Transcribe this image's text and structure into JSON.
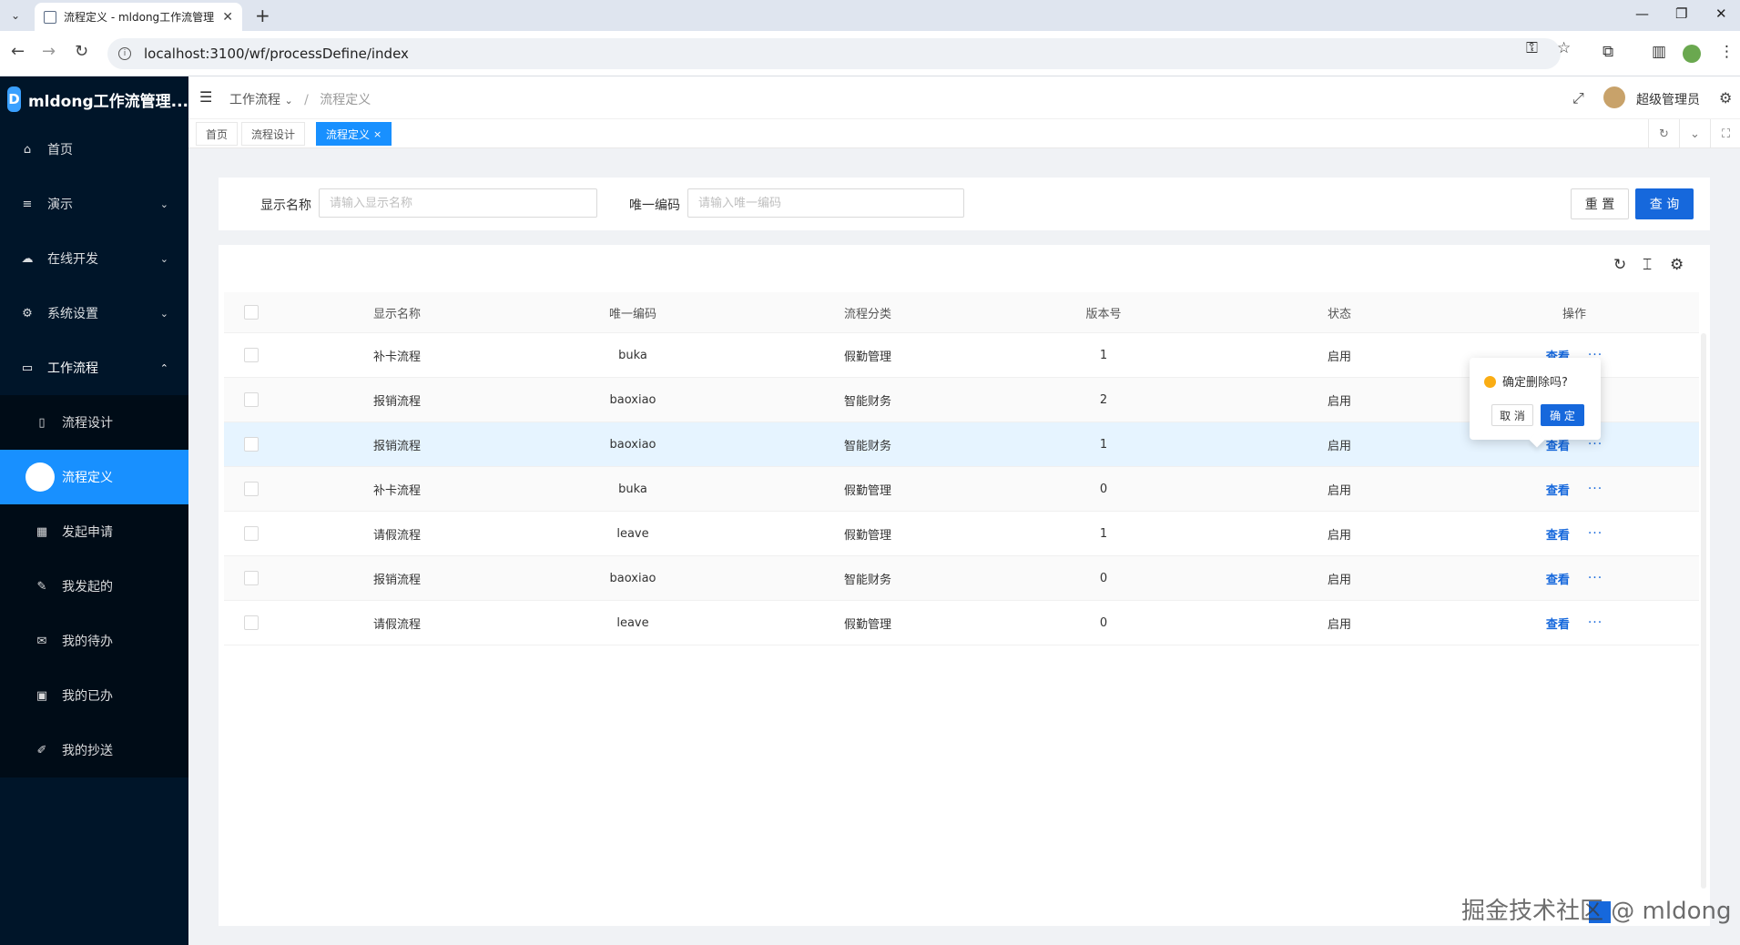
{
  "browser": {
    "tab_title": "流程定义 - mldong工作流管理",
    "url": "localhost:3100/wf/processDefine/index"
  },
  "app": {
    "logo_text": "mldong工作流管理...",
    "user_name": "超级管理员"
  },
  "sidebar": {
    "items": [
      {
        "label": "首页",
        "icon": "home-icon"
      },
      {
        "label": "演示",
        "icon": "list-icon"
      },
      {
        "label": "在线开发",
        "icon": "cloud-icon"
      },
      {
        "label": "系统设置",
        "icon": "gear-icon"
      },
      {
        "label": "工作流程",
        "icon": "desktop-icon"
      }
    ],
    "sub_items": [
      {
        "label": "流程设计",
        "icon": "file-icon"
      },
      {
        "label": "流程定义",
        "icon": "circle-icon"
      },
      {
        "label": "发起申请",
        "icon": "grid-icon"
      },
      {
        "label": "我发起的",
        "icon": "edit-icon"
      },
      {
        "label": "我的待办",
        "icon": "mail-icon"
      },
      {
        "label": "我的已办",
        "icon": "book-icon"
      },
      {
        "label": "我的抄送",
        "icon": "pen-icon"
      }
    ]
  },
  "breadcrumb": {
    "parent": "工作流程",
    "current": "流程定义"
  },
  "page_tabs": [
    {
      "label": "首页"
    },
    {
      "label": "流程设计"
    },
    {
      "label": "流程定义",
      "active": true
    }
  ],
  "search": {
    "name_label": "显示名称",
    "name_placeholder": "请输入显示名称",
    "code_label": "唯一编码",
    "code_placeholder": "请输入唯一编码",
    "reset_label": "重 置",
    "query_label": "查 询"
  },
  "table": {
    "columns": [
      "显示名称",
      "唯一编码",
      "流程分类",
      "版本号",
      "状态",
      "操作"
    ],
    "rows": [
      {
        "name": "补卡流程",
        "code": "buka",
        "category": "假勤管理",
        "version": "1",
        "status": "启用"
      },
      {
        "name": "报销流程",
        "code": "baoxiao",
        "category": "智能财务",
        "version": "2",
        "status": "启用"
      },
      {
        "name": "报销流程",
        "code": "baoxiao",
        "category": "智能财务",
        "version": "1",
        "status": "启用"
      },
      {
        "name": "补卡流程",
        "code": "buka",
        "category": "假勤管理",
        "version": "0",
        "status": "启用"
      },
      {
        "name": "请假流程",
        "code": "leave",
        "category": "假勤管理",
        "version": "1",
        "status": "启用"
      },
      {
        "name": "报销流程",
        "code": "baoxiao",
        "category": "智能财务",
        "version": "0",
        "status": "启用"
      },
      {
        "name": "请假流程",
        "code": "leave",
        "category": "假勤管理",
        "version": "0",
        "status": "启用"
      }
    ],
    "view_label": "查看",
    "more_label": "···"
  },
  "popconfirm": {
    "message": "确定删除吗?",
    "cancel_label": "取 消",
    "ok_label": "确 定"
  },
  "watermark": "掘金技术社区 @ mldong",
  "colors": {
    "primary": "#1668dc",
    "sidebar_bg": "#001529",
    "active_menu": "#1890ff",
    "warning": "#faad14"
  }
}
